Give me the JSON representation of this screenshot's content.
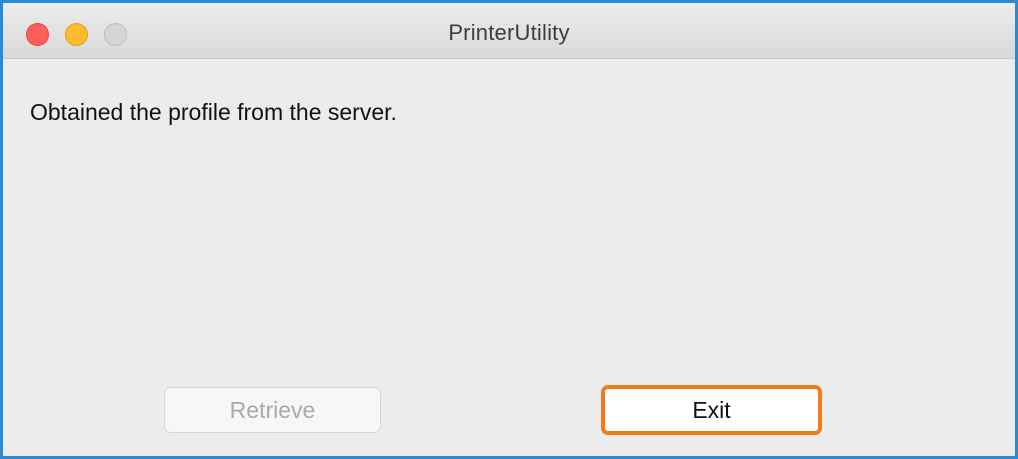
{
  "window": {
    "title": "PrinterUtility",
    "traffic_lights": {
      "close_color": "#fc5f57",
      "minimize_color": "#fdbc2e",
      "zoom_color": "#d5d5d5"
    }
  },
  "dialog": {
    "message": "Obtained the profile from the server."
  },
  "buttons": {
    "retrieve": {
      "label": "Retrieve",
      "enabled": false
    },
    "exit": {
      "label": "Exit",
      "highlight_color": "#f07d1b"
    }
  },
  "colors": {
    "window_border": "#2b8ad6",
    "background": "#ececec"
  }
}
